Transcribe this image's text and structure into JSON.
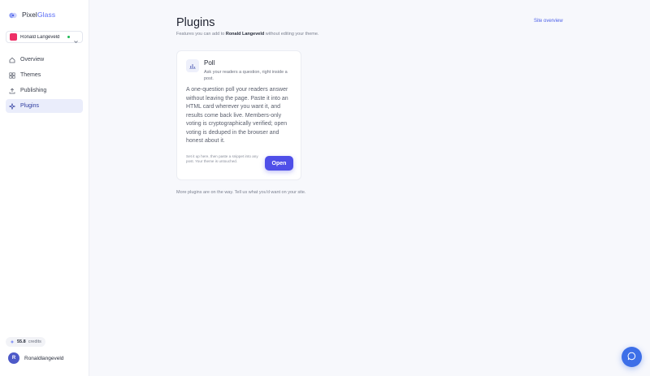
{
  "brand": {
    "name_prefix": "Pixel",
    "name_suffix": "Glass"
  },
  "site_selector": {
    "name": "Ronald Langeveld",
    "avatar_color": "#ee2f66",
    "status_color": "#1db954"
  },
  "sidebar": {
    "items": [
      {
        "label": "Overview",
        "icon": "home-icon"
      },
      {
        "label": "Themes",
        "icon": "grid-icon"
      },
      {
        "label": "Publishing",
        "icon": "upload-icon"
      },
      {
        "label": "Plugins",
        "icon": "sparkle-icon",
        "active": true
      }
    ]
  },
  "credits": {
    "value": "55.8",
    "label": "credits"
  },
  "user": {
    "initial": "R",
    "name": "Ronaldlangeveld"
  },
  "header": {
    "title": "Plugins",
    "subtitle_before": "Features you can add to ",
    "subtitle_name": "Ronald Langeveld",
    "subtitle_after": " without editing your theme.",
    "overview_link": "Site overview"
  },
  "plugin_card": {
    "title": "Poll",
    "tagline": "Ask your readers a question, right inside a post.",
    "description": "A one-question poll your readers answer without leaving the page. Paste it into an HTML card wherever you want it, and results come back live. Members-only voting is cryptographically verified; open voting is deduped in the browser and honest about it.",
    "hint": "Set it up here, then paste a snippet into any post. Your theme is untouched.",
    "button_label": "Open"
  },
  "footer_note": "More plugins are on the way. Tell us what you'd want on your site.",
  "colors": {
    "accent": "#4f4fe8",
    "link": "#4a5ee8",
    "active_nav_bg": "#eaedfb",
    "fab": "#3d6fe8"
  }
}
